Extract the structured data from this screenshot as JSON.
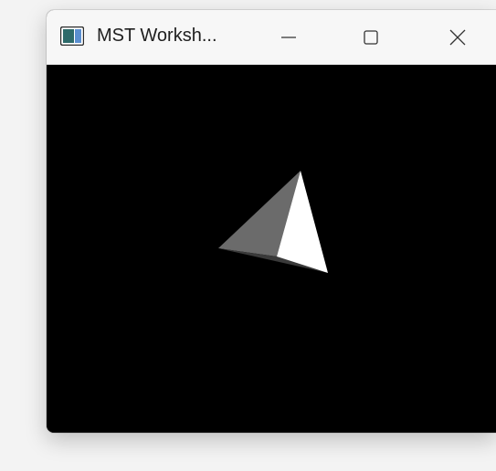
{
  "window": {
    "title": "MST Worksh...",
    "minimize_glyph": "—",
    "maximize_glyph": "☐",
    "close_glyph": "✕",
    "app_icon": "window-app-icon"
  },
  "viewport": {
    "background": "#000000",
    "object": "tetrahedron",
    "face_colors": {
      "lit": "#ffffff",
      "mid": "#6b6b6b",
      "dark": "#3a3a3a"
    }
  }
}
